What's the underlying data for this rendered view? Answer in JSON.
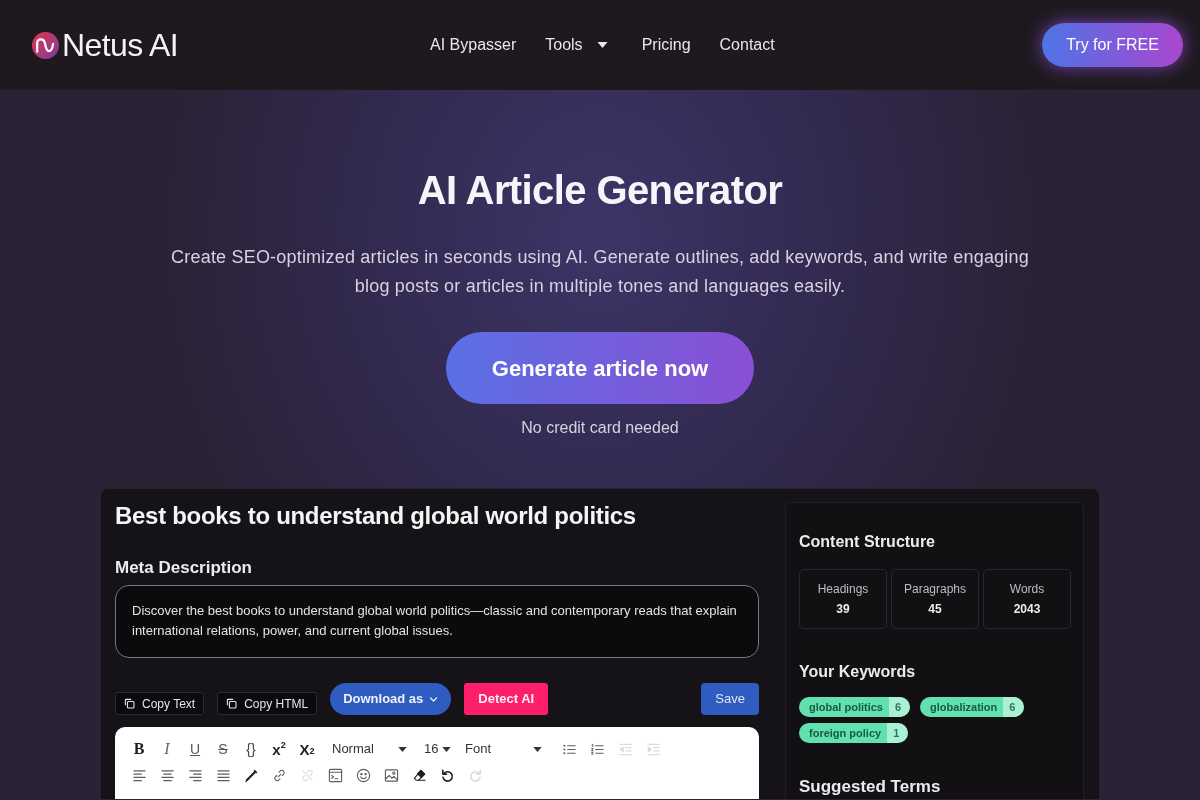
{
  "nav": {
    "logo_text": "Netus AI",
    "links": [
      {
        "label": "AI Bypasser",
        "dropdown": false
      },
      {
        "label": "Tools",
        "dropdown": true
      },
      {
        "label": "Pricing",
        "dropdown": false
      },
      {
        "label": "Contact",
        "dropdown": false
      }
    ],
    "cta": "Try for FREE"
  },
  "hero": {
    "title": "AI Article Generator",
    "subtitle": "Create SEO-optimized articles in seconds using AI. Generate outlines, add keywords, and write engaging blog posts or articles in multiple tones and languages easily.",
    "button": "Generate article now",
    "note": "No credit card needed"
  },
  "editor": {
    "title": "Best books to understand global world politics",
    "meta_label": "Meta Description",
    "meta_value": "Discover the best books to understand global world politics—classic and contemporary reads that explain international relations, power, and current global issues.",
    "actions": [
      {
        "label": "Copy Text",
        "kind": "copy"
      },
      {
        "label": "Copy HTML",
        "kind": "copy"
      },
      {
        "label": "Download as",
        "kind": "menu"
      },
      {
        "label": "Detect AI",
        "kind": "detect"
      },
      {
        "label": "Save",
        "kind": "save"
      }
    ],
    "toolbar": {
      "format_buttons": [
        {
          "label": "B",
          "kind": "bold"
        },
        {
          "label": "I",
          "kind": "italic"
        },
        {
          "label": "U",
          "kind": "underline"
        },
        {
          "label": "S",
          "kind": "strike"
        },
        {
          "label": "{}",
          "kind": "code"
        },
        {
          "label": "x$^{2}$",
          "kind": "superscript"
        },
        {
          "label": "X$_{2}$",
          "kind": "subscript"
        }
      ],
      "selects": [
        {
          "value": "Normal"
        },
        {
          "value": "16"
        },
        {
          "value": "Font"
        }
      ],
      "row_1_tools": [
        {
          "kind": "bullets",
          "disabled": false
        },
        {
          "kind": "numbers",
          "disabled": false
        },
        {
          "kind": "outdent",
          "disabled": true
        },
        {
          "kind": "indent",
          "disabled": true
        }
      ],
      "row_2_tools": [
        {
          "kind": "left",
          "disabled": false
        },
        {
          "kind": "center",
          "disabled": false
        },
        {
          "kind": "right",
          "disabled": false
        },
        {
          "kind": "justify",
          "disabled": false
        },
        {
          "kind": "pen",
          "disabled": false
        },
        {
          "kind": "link",
          "disabled": false
        },
        {
          "kind": "unlink",
          "disabled": true
        },
        {
          "kind": "embed",
          "disabled": false
        },
        {
          "kind": "emoji",
          "disabled": false
        },
        {
          "kind": "image",
          "disabled": false
        },
        {
          "kind": "eraser",
          "disabled": false
        },
        {
          "kind": "undo",
          "disabled": false
        },
        {
          "kind": "redo",
          "disabled": true
        }
      ]
    }
  },
  "sidebar": {
    "structure_title": "Content Structure",
    "stats": [
      {
        "label": "Headings",
        "value": "39"
      },
      {
        "label": "Paragraphs",
        "value": "45"
      },
      {
        "label": "Words",
        "value": "2043"
      }
    ],
    "keywords_title": "Your Keywords",
    "keywords": [
      {
        "term": "global politics",
        "count": "6"
      },
      {
        "term": "globalization",
        "count": "6"
      },
      {
        "term": "foreign policy",
        "count": "1"
      }
    ],
    "suggested_title": "Suggested Terms"
  }
}
